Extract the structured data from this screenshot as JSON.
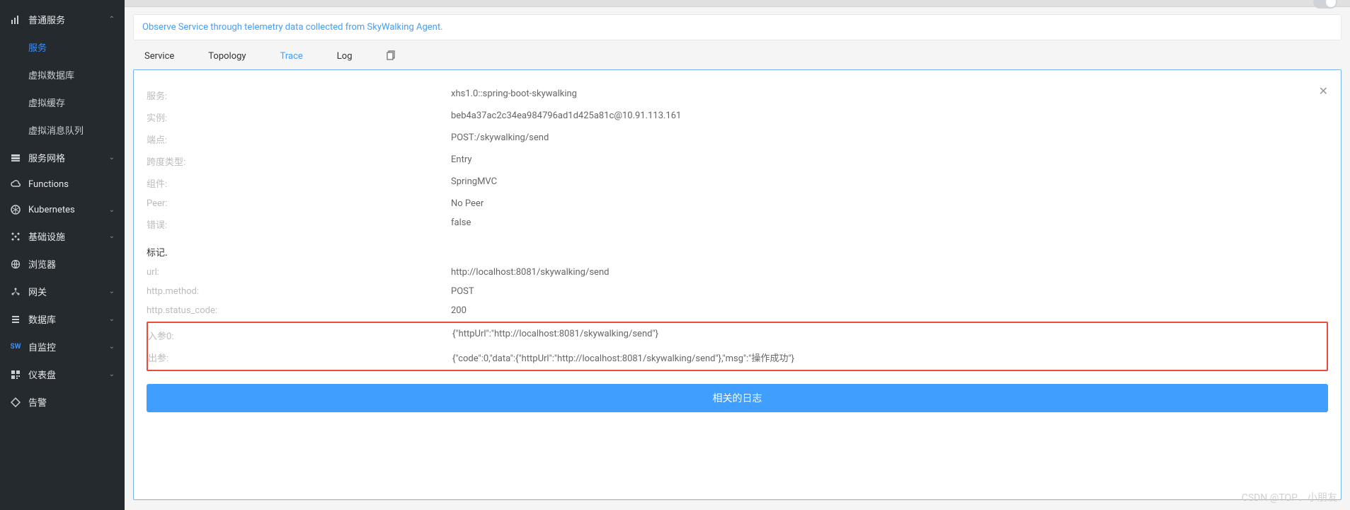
{
  "sidebar": {
    "groups": [
      {
        "label": "普通服务",
        "expanded": true,
        "icon": "bar-chart-icon",
        "children": [
          {
            "label": "服务",
            "active": true
          },
          {
            "label": "虚拟数据库"
          },
          {
            "label": "虚拟缓存"
          },
          {
            "label": "虚拟消息队列"
          }
        ]
      },
      {
        "label": "服务网格",
        "expanded": false,
        "icon": "layers-icon"
      },
      {
        "label": "Functions",
        "expanded": null,
        "icon": "cloud-icon"
      },
      {
        "label": "Kubernetes",
        "expanded": false,
        "icon": "kubernetes-icon"
      },
      {
        "label": "基础设施",
        "expanded": false,
        "icon": "infra-icon"
      },
      {
        "label": "浏览器",
        "expanded": null,
        "icon": "globe-icon"
      },
      {
        "label": "网关",
        "expanded": false,
        "icon": "gateway-icon"
      },
      {
        "label": "数据库",
        "expanded": false,
        "icon": "database-icon"
      },
      {
        "label": "自监控",
        "expanded": false,
        "icon": "sw-icon"
      },
      {
        "label": "仪表盘",
        "expanded": false,
        "icon": "dashboard-icon"
      },
      {
        "label": "告警",
        "expanded": null,
        "icon": "alert-icon"
      }
    ]
  },
  "banner": "Observe Service through telemetry data collected from SkyWalking Agent.",
  "tabs": [
    {
      "label": "Service"
    },
    {
      "label": "Topology"
    },
    {
      "label": "Trace",
      "active": true
    },
    {
      "label": "Log"
    }
  ],
  "detail": {
    "rows": [
      {
        "k": "服务:",
        "v": "xhs1.0::spring-boot-skywalking"
      },
      {
        "k": "实例:",
        "v": "beb4a37ac2c34ea984796ad1d425a81c@10.91.113.161"
      },
      {
        "k": "端点:",
        "v": "POST:/skywalking/send"
      },
      {
        "k": "跨度类型:",
        "v": "Entry"
      },
      {
        "k": "组件:",
        "v": "SpringMVC"
      },
      {
        "k": "Peer:",
        "v": "No Peer"
      },
      {
        "k": "错误:",
        "v": "false"
      }
    ],
    "tagsTitle": "标记.",
    "tags": [
      {
        "k": "url:",
        "v": "http://localhost:8081/skywalking/send"
      },
      {
        "k": "http.method:",
        "v": "POST"
      },
      {
        "k": "http.status_code:",
        "v": "200"
      }
    ],
    "params": [
      {
        "k": "入参0:",
        "v": "{\"httpUrl\":\"http://localhost:8081/skywalking/send\"}"
      },
      {
        "k": "出参:",
        "v": "{\"code\":0,\"data\":{\"httpUrl\":\"http://localhost:8081/skywalking/send\"},\"msg\":\"操作成功\"}"
      }
    ],
    "button": "相关的日志"
  },
  "watermark": "CSDN @TOP、小朋友"
}
